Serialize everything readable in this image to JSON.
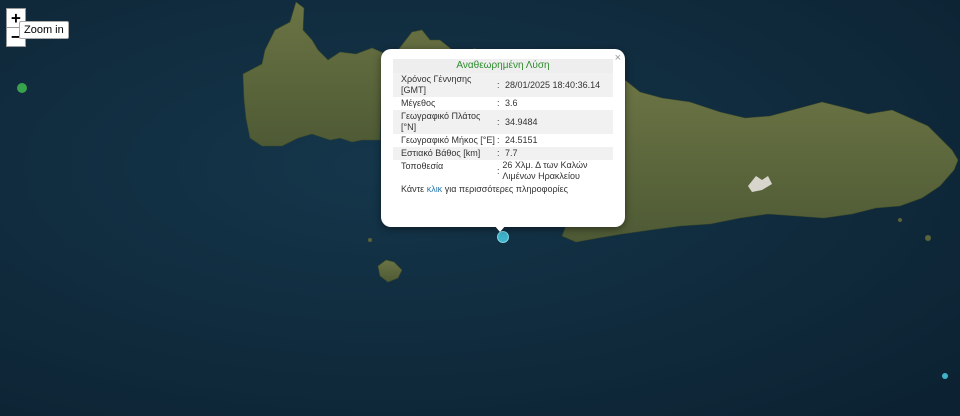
{
  "map": {
    "zoom_in_label": "+",
    "zoom_out_label": "−",
    "tooltip": "Zoom in",
    "colors": {
      "sea": "#0f2a3b",
      "land": "#5f6a3a",
      "marker_epicenter": "#3fb3c9",
      "marker_green": "#39a24d"
    }
  },
  "popup": {
    "title": "Αναθεωρημένη Λύση",
    "close": "×",
    "rows": [
      {
        "label": "Χρόνος Γέννησης [GMT]",
        "value": "28/01/2025 18:40:36.14"
      },
      {
        "label": "Μέγεθος",
        "value": "3.6"
      },
      {
        "label": "Γεωγραφικό Πλάτος [°N]",
        "value": "34.9484"
      },
      {
        "label": "Γεωγραφικό Μήκος [°E]",
        "value": "24.5151"
      },
      {
        "label": "Εστιακό Βάθος [km]",
        "value": "7.7"
      },
      {
        "label": "Τοποθεσία",
        "value": "26 Χλμ. Δ των Καλών Λιμένων Ηρακλείου"
      }
    ],
    "row_separator": ":",
    "footer_before": "Κάντε",
    "footer_link": "κλικ",
    "footer_after": "για περισσότερες πληροφορίες"
  }
}
